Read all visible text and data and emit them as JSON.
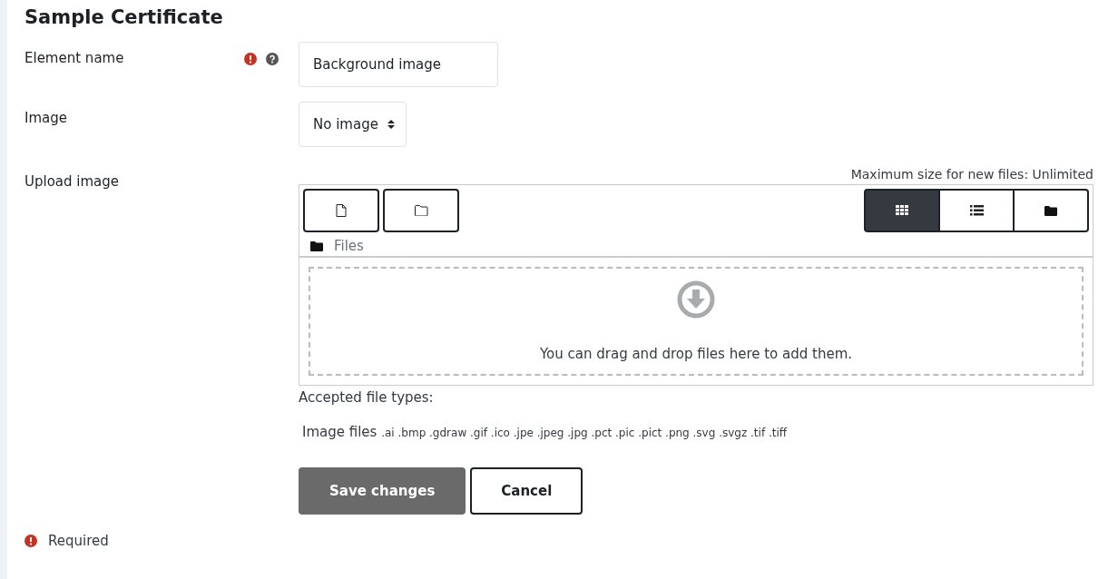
{
  "title": "Sample Certificate",
  "element_name": {
    "label": "Element name",
    "required": true,
    "value": "Background image"
  },
  "image": {
    "label": "Image",
    "value": "No image"
  },
  "upload": {
    "label": "Upload image",
    "max_size": "Maximum size for new files: Unlimited",
    "view_buttons": [
      {
        "kind": "grid",
        "selected": true
      },
      {
        "kind": "list",
        "selected": false
      },
      {
        "kind": "tree",
        "selected": false
      }
    ],
    "path": "Files",
    "drop_text": "You can drag and drop files here to add them.",
    "accepted_label": "Accepted file types:",
    "accepted_name": "Image files",
    "accepted_ext": ".ai .bmp .gdraw .gif .ico .jpe .jpeg .jpg .pct .pic .pict .png .svg .svgz .tif .tiff"
  },
  "buttons": [
    {
      "kind": "primary",
      "label": "Save changes"
    },
    {
      "kind": "secondary",
      "label": "Cancel"
    }
  ],
  "required_note": "Required"
}
